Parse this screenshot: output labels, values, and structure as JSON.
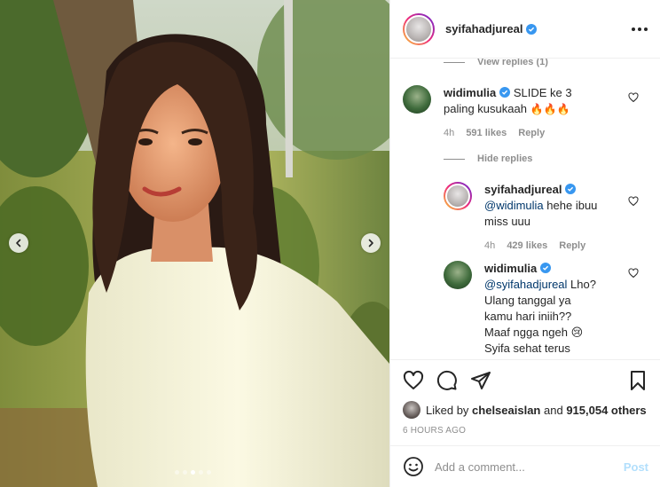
{
  "post": {
    "username": "syifahadjureal",
    "more_icon": "more-horizontal-icon"
  },
  "photo": {
    "dots": 5,
    "active_dot": 3,
    "prev_icon": "chevron-left-icon",
    "next_icon": "chevron-right-icon"
  },
  "comments": {
    "view_replies_label": "View replies (1)",
    "hide_replies_label": "Hide replies",
    "items": [
      {
        "user": "widimulia",
        "text": "SLIDE ke 3 paling kusukaah",
        "emoji": "🔥🔥🔥",
        "time": "4h",
        "likes": "591 likes",
        "reply": "Reply"
      },
      {
        "user": "syifahadjureal",
        "mention": "@widimulia",
        "text": "hehe ibuu miss uuu",
        "time": "4h",
        "likes": "429 likes",
        "reply": "Reply"
      },
      {
        "user": "widimulia",
        "mention": "@syifahadjureal",
        "text": "Lho? Ulang tanggal ya kamu hari iniih?? Maaf ngga ngeh 😢 Syifa sehat terus please, semoga diringankan semua"
      }
    ]
  },
  "liked_by": {
    "prefix": "Liked by",
    "user": "chelseaislan",
    "middle": "and",
    "count": "915,054 others"
  },
  "timestamp": "6 HOURS AGO",
  "add_comment": {
    "placeholder": "Add a comment...",
    "post_label": "Post"
  },
  "colors": {
    "verified": "#3897f0",
    "post_disabled": "#b2dffc",
    "muted": "#8e8e8e"
  }
}
